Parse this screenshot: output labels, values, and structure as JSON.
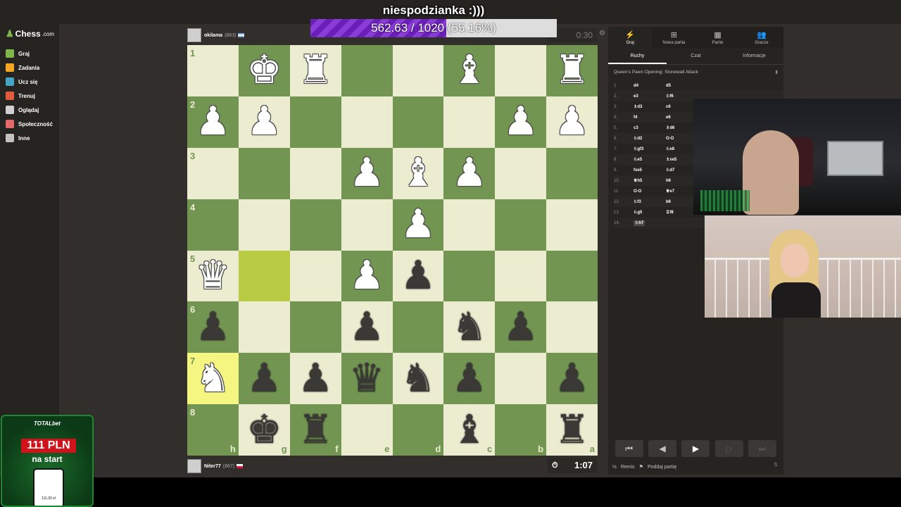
{
  "overlay": {
    "title": "niespodzianka :)))",
    "progress_text": "562.63 / 1020 (55.16%)",
    "progress_value": 0.5516
  },
  "sidebar": {
    "logo": "Chess",
    "logo_suffix": ".com",
    "items": [
      {
        "label": "Graj",
        "color": "#81b64c"
      },
      {
        "label": "Zadania",
        "color": "#f5a623"
      },
      {
        "label": "Ucz się",
        "color": "#46a4c5"
      },
      {
        "label": "Trenuj",
        "color": "#e25a3d"
      },
      {
        "label": "Oglądaj",
        "color": "#cfcfcf"
      },
      {
        "label": "Społeczność",
        "color": "#e26a6a"
      },
      {
        "label": "Inne",
        "color": "#c3c2c1"
      }
    ]
  },
  "top_player": {
    "name": "okilama",
    "rating": "(883)",
    "clock": "0:30"
  },
  "bottom_player": {
    "name": "Niter77",
    "rating": "(867)",
    "clock": "1:07"
  },
  "board": {
    "ranks": [
      "1",
      "2",
      "3",
      "4",
      "5",
      "6",
      "7",
      "8"
    ],
    "files": [
      "h",
      "g",
      "f",
      "e",
      "d",
      "c",
      "b",
      "a"
    ],
    "rows": [
      [
        "",
        "wK",
        "wR",
        "",
        "",
        "wB",
        "",
        "wR"
      ],
      [
        "wP",
        "wP",
        "",
        "",
        "",
        "",
        "wP",
        "wP"
      ],
      [
        "",
        "",
        "",
        "wP",
        "wB",
        "wP",
        "",
        ""
      ],
      [
        "",
        "",
        "",
        "",
        "wP",
        "",
        "",
        ""
      ],
      [
        "wQ",
        "",
        "",
        "wP",
        "bP",
        "",
        "",
        ""
      ],
      [
        "bP",
        "",
        "",
        "bP",
        "",
        "bN",
        "bP",
        ""
      ],
      [
        "wN",
        "bP",
        "bP",
        "bQ",
        "bN",
        "bP",
        "",
        "bP"
      ],
      [
        "",
        "bK",
        "bR",
        "",
        "",
        "bB",
        "",
        "bR"
      ]
    ],
    "highlight": [
      [
        4,
        1
      ],
      [
        6,
        0
      ]
    ]
  },
  "panel": {
    "tabs": [
      {
        "label": "Graj",
        "icon": "lightning-icon"
      },
      {
        "label": "Nowa partia",
        "icon": "plus-icon"
      },
      {
        "label": "Partie",
        "icon": "board-icon"
      },
      {
        "label": "Gracze",
        "icon": "players-icon"
      }
    ],
    "subtabs": [
      "Ruchy",
      "Czat",
      "Informacje"
    ],
    "opening": "Queen's Pawn Opening: Stonewall Attack",
    "moves": [
      {
        "n": "1.",
        "w": "d4",
        "b": "d5"
      },
      {
        "n": "2.",
        "w": "e3",
        "b": "♘f6"
      },
      {
        "n": "3.",
        "w": "♗d3",
        "b": "c6"
      },
      {
        "n": "4.",
        "w": "f4",
        "b": "e6"
      },
      {
        "n": "5.",
        "w": "c3",
        "b": "♗d6"
      },
      {
        "n": "6.",
        "w": "♘d2",
        "b": "O-O"
      },
      {
        "n": "7.",
        "w": "♘gf3",
        "b": "♘e8"
      },
      {
        "n": "8.",
        "w": "♘e5",
        "b": "♗xe5"
      },
      {
        "n": "9.",
        "w": "fxe5",
        "b": "♘d7"
      },
      {
        "n": "10.",
        "w": "♕h5",
        "b": "h6"
      },
      {
        "n": "11.",
        "w": "O-O",
        "b": "♕e7"
      },
      {
        "n": "12.",
        "w": "♘f3",
        "b": "b6"
      },
      {
        "n": "13.",
        "w": "♘g5",
        "b": "♖f8"
      },
      {
        "n": "14.",
        "w": "♘h7",
        "b": ""
      }
    ],
    "remis": "Remis",
    "resign": "Poddaj partię"
  },
  "ad": {
    "brand": "TOTALbet",
    "amount": "111 PLN",
    "sub": "na start",
    "phone_amount": "111,00 zł"
  }
}
